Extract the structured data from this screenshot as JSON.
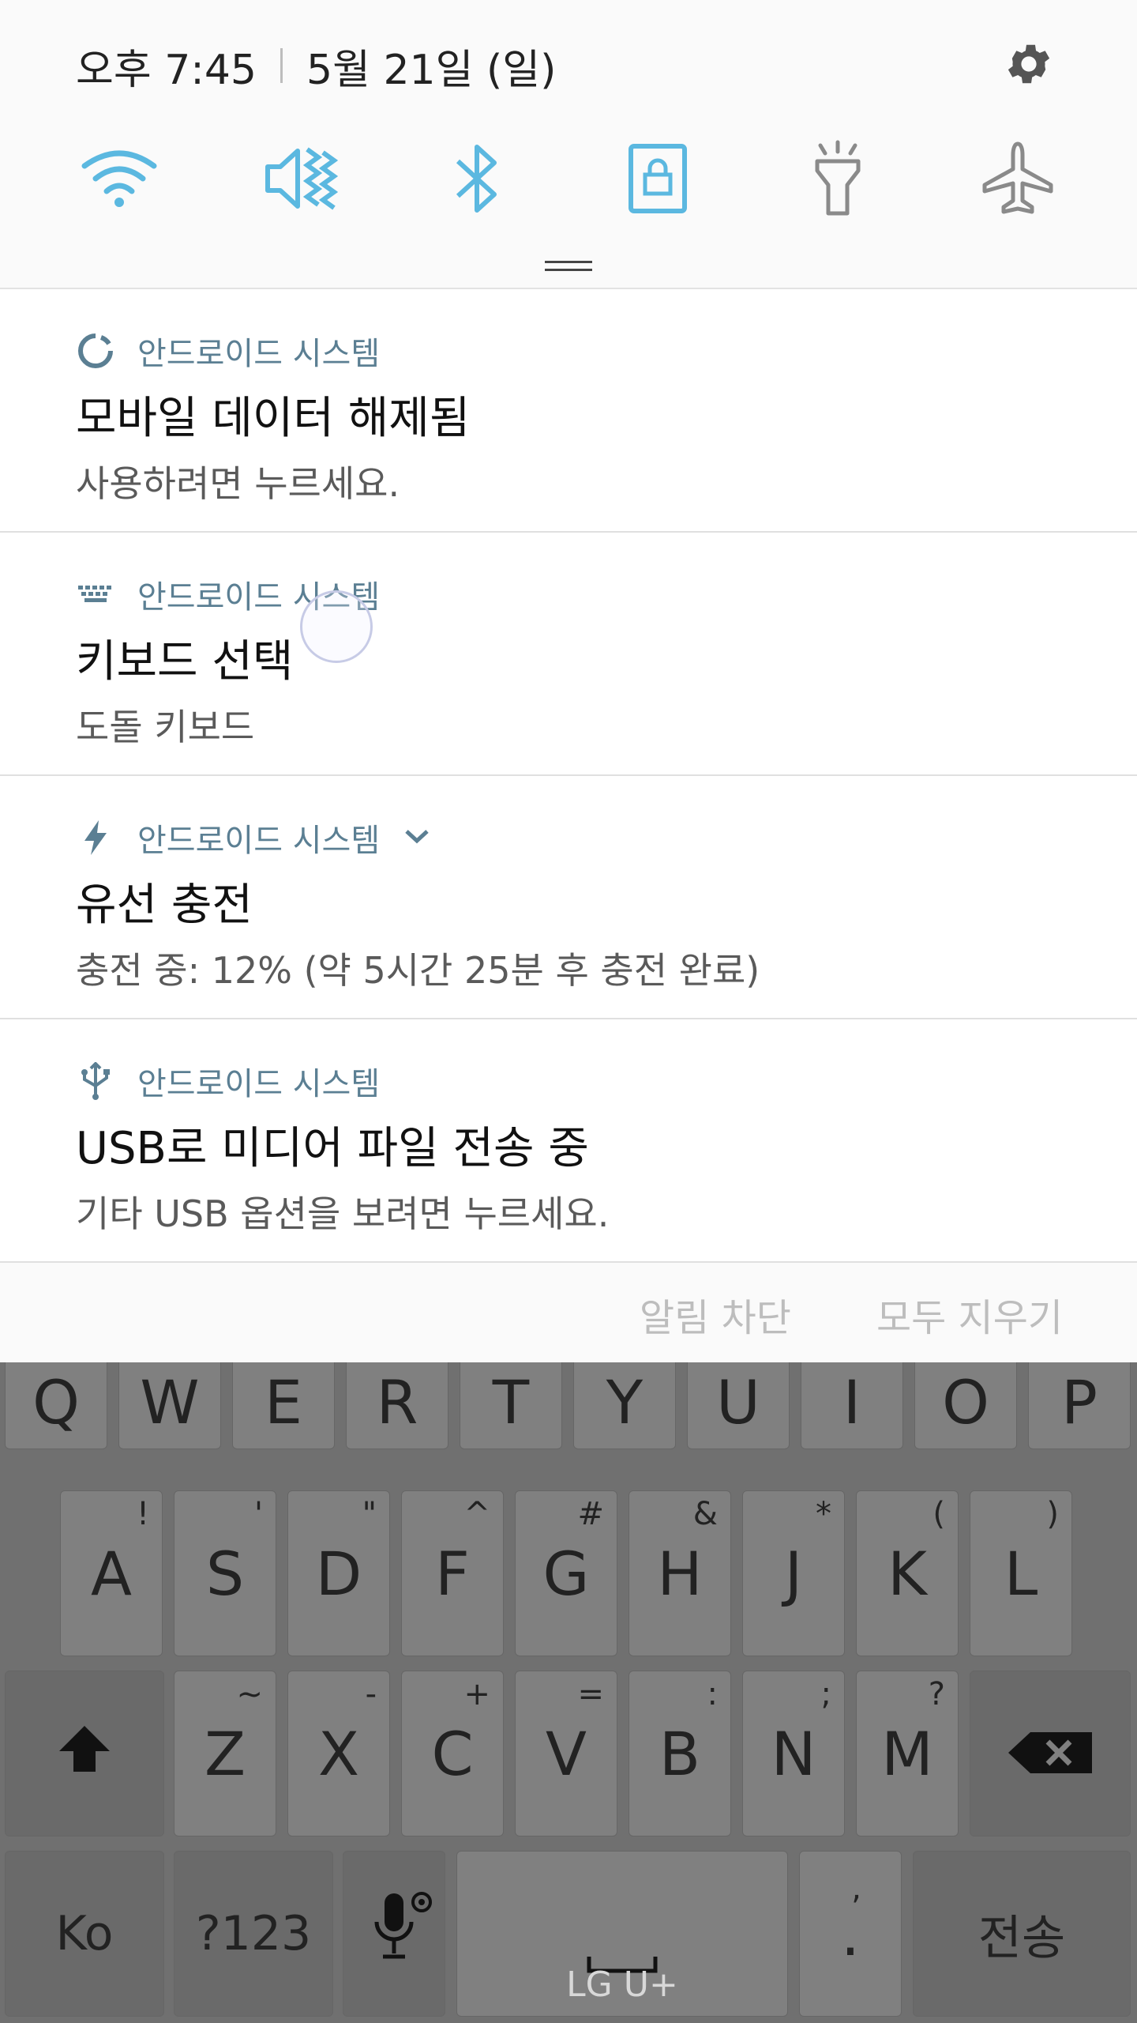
{
  "status": {
    "time": "오후 7:45",
    "date": "5월 21일 (일)"
  },
  "quick_settings": {
    "icons": [
      "wifi-icon",
      "mute-vibrate-icon",
      "bluetooth-icon",
      "screen-lock-icon",
      "flashlight-icon",
      "airplane-mode-icon"
    ],
    "colors": {
      "active": "#5bb8e0",
      "inactive": "#8a8a8a"
    }
  },
  "notifications": [
    {
      "app": "안드로이드 시스템",
      "icon": "sync-icon",
      "title": "모바일 데이터 해제됨",
      "text": "사용하려면 누르세요."
    },
    {
      "app": "안드로이드 시스템",
      "icon": "keyboard-icon",
      "title": "키보드 선택",
      "text": "도돌 키보드"
    },
    {
      "app": "안드로이드 시스템",
      "icon": "charging-icon",
      "title": "유선 충전",
      "text": "충전 중: 12% (약 5시간 25분 후 충전 완료)"
    },
    {
      "app": "안드로이드 시스템",
      "icon": "usb-icon",
      "title": "USB로 미디어 파일 전송 중",
      "text": "기타 USB 옵션을 보려면 누르세요."
    }
  ],
  "actions": {
    "block": "알림 차단",
    "clear_all": "모두 지우기"
  },
  "keyboard": {
    "row1": [
      "Q",
      "W",
      "E",
      "R",
      "T",
      "Y",
      "U",
      "I",
      "O",
      "P"
    ],
    "row2": [
      {
        "k": "A",
        "s": "!"
      },
      {
        "k": "S",
        "s": "'"
      },
      {
        "k": "D",
        "s": "\""
      },
      {
        "k": "F",
        "s": "^"
      },
      {
        "k": "G",
        "s": "#"
      },
      {
        "k": "H",
        "s": "&"
      },
      {
        "k": "J",
        "s": "*"
      },
      {
        "k": "K",
        "s": "("
      },
      {
        "k": "L",
        "s": ")"
      }
    ],
    "row3": [
      {
        "k": "Z",
        "s": "~"
      },
      {
        "k": "X",
        "s": "-"
      },
      {
        "k": "C",
        "s": "+"
      },
      {
        "k": "V",
        "s": "="
      },
      {
        "k": "B",
        "s": ":"
      },
      {
        "k": "N",
        "s": ";"
      },
      {
        "k": "M",
        "s": "?"
      }
    ],
    "lang": "Ko",
    "symbols": "?123",
    "space_label": "LG U+",
    "period": ".",
    "period_sub": ",",
    "send": "전송"
  }
}
